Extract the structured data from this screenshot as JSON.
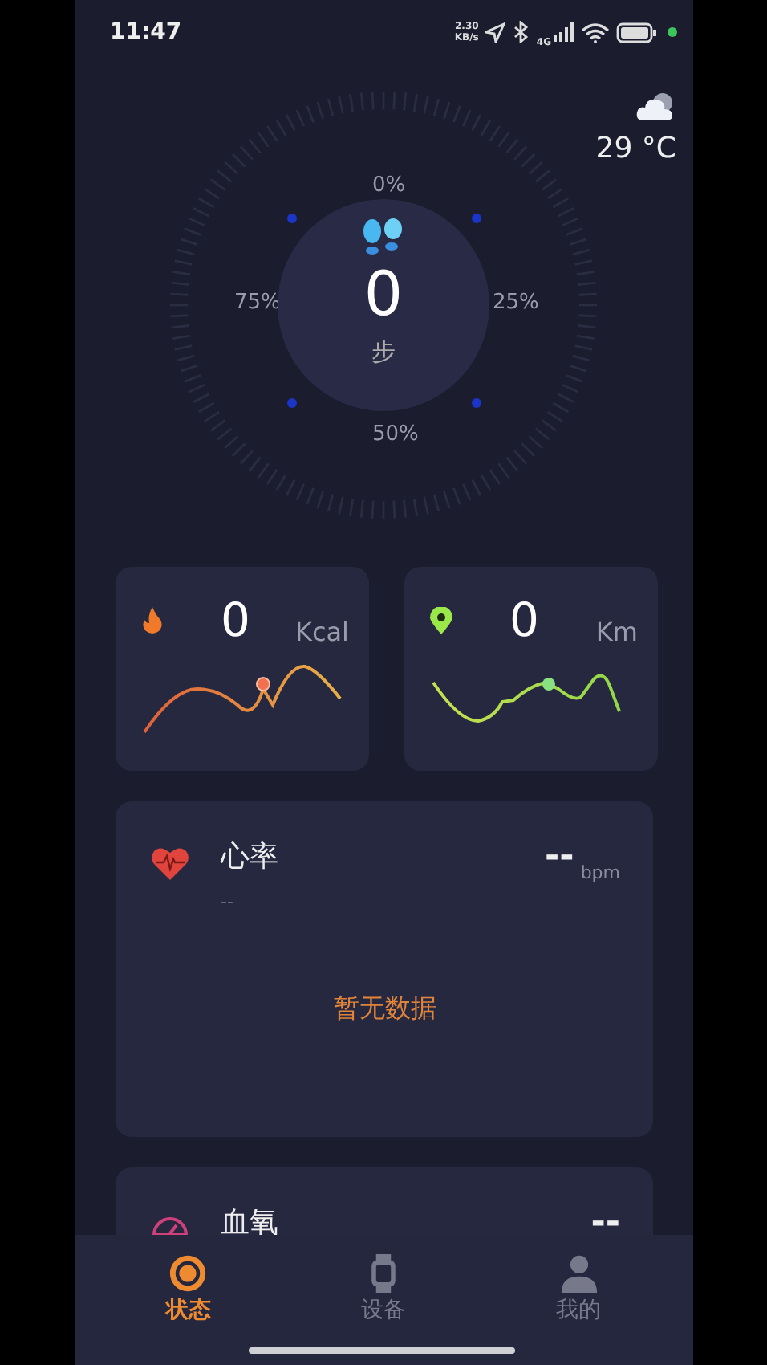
{
  "status_bar": {
    "time": "11:47",
    "net_speed": "2.30",
    "net_unit": "KB/s",
    "network": "4G"
  },
  "weather": {
    "temperature": "29 °C"
  },
  "steps": {
    "value": "0",
    "unit": "步",
    "marks": [
      "0%",
      "25%",
      "50%",
      "75%"
    ]
  },
  "stats": [
    {
      "kind": "calories",
      "value": "0",
      "unit": "Kcal"
    },
    {
      "kind": "distance",
      "value": "0",
      "unit": "Km"
    }
  ],
  "metrics": [
    {
      "kind": "heart",
      "title": "心率",
      "value": "--",
      "unit": "bpm",
      "subtitle": "--",
      "empty_text": "暂无数据"
    },
    {
      "kind": "oxygen",
      "title": "血氧",
      "value": "--"
    }
  ],
  "tabs": [
    {
      "kind": "status",
      "label": "状态",
      "selected": true
    },
    {
      "kind": "device",
      "label": "设备",
      "selected": false
    },
    {
      "kind": "profile",
      "label": "我的",
      "selected": false
    }
  ]
}
